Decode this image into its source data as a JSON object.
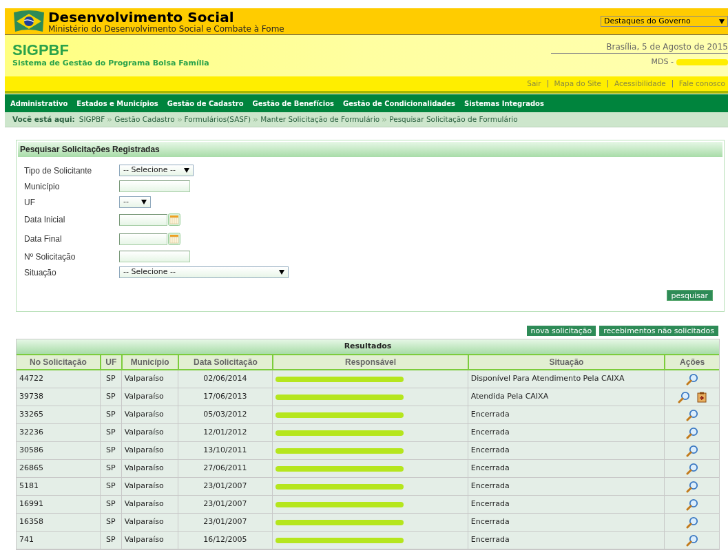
{
  "header": {
    "title": "Desenvolvimento Social",
    "subtitle": "Ministério do Desenvolvimento Social e Combate à Fome",
    "dropdown": "Destaques do Governo"
  },
  "banner": {
    "title": "SIGPBF",
    "subtitle": "Sistema de Gestão do Programa Bolsa Família",
    "date": "Brasília, 5 de Agosto de 2015",
    "user_prefix": "MDS -",
    "user_redacted": true
  },
  "top_links": [
    "Sair",
    "Mapa do Site",
    "Acessibilidade",
    "Fale conosco"
  ],
  "menu": [
    "Administrativo",
    "Estados e Municípios",
    "Gestão de Cadastro",
    "Gestão de Benefícios",
    "Gestão de Condicionalidades",
    "Sistemas Integrados"
  ],
  "breadcrumb": {
    "label": "Você está aqui:",
    "items": [
      "SIGPBF",
      "Gestão Cadastro",
      "Formulários(SASF)",
      "Manter Solicitação de Formulário",
      "Pesquisar Solicitação de Formulário"
    ]
  },
  "search_panel": {
    "title": "Pesquisar Solicitações Registradas",
    "fields": [
      {
        "label": "Tipo de Solicitante",
        "kind": "select",
        "value": "-- Selecione --"
      },
      {
        "label": "Município",
        "kind": "text"
      },
      {
        "label": "UF",
        "kind": "select",
        "value": "--"
      },
      {
        "label": "Data Inicial",
        "kind": "date"
      },
      {
        "label": "Data Final",
        "kind": "date"
      },
      {
        "label": "Nº Solicitação",
        "kind": "text"
      },
      {
        "label": "Situação",
        "kind": "select",
        "value": "-- Selecione --"
      }
    ],
    "button": "pesquisar"
  },
  "result_buttons": [
    "nova solicitação",
    "recebimentos não solicitados"
  ],
  "results": {
    "title": "Resultados",
    "columns": [
      "No Solicitação",
      "UF",
      "Município",
      "Data Solicitação",
      "Responsável",
      "Situação",
      "Ações"
    ],
    "rows": [
      {
        "number": "44722",
        "uf": "SP",
        "municipio": "Valparaíso",
        "date": "02/06/2014",
        "responsavel_redacted": true,
        "situacao": "Disponível Para Atendimento Pela CAIXA",
        "actions": [
          {
            "kind": "view"
          }
        ]
      },
      {
        "number": "39738",
        "uf": "SP",
        "municipio": "Valparaíso",
        "date": "17/06/2013",
        "responsavel_redacted": true,
        "situacao": "Atendida Pela CAIXA",
        "actions": [
          {
            "kind": "view"
          },
          {
            "kind": "receive"
          }
        ]
      },
      {
        "number": "33265",
        "uf": "SP",
        "municipio": "Valparaíso",
        "date": "05/03/2012",
        "responsavel_redacted": true,
        "situacao": "Encerrada",
        "actions": [
          {
            "kind": "view"
          }
        ]
      },
      {
        "number": "32236",
        "uf": "SP",
        "municipio": "Valparaíso",
        "date": "12/01/2012",
        "responsavel_redacted": true,
        "situacao": "Encerrada",
        "actions": [
          {
            "kind": "view"
          }
        ]
      },
      {
        "number": "30586",
        "uf": "SP",
        "municipio": "Valparaíso",
        "date": "13/10/2011",
        "responsavel_redacted": true,
        "situacao": "Encerrada",
        "actions": [
          {
            "kind": "view"
          }
        ]
      },
      {
        "number": "26865",
        "uf": "SP",
        "municipio": "Valparaíso",
        "date": "27/06/2011",
        "responsavel_redacted": true,
        "situacao": "Encerrada",
        "actions": [
          {
            "kind": "view"
          }
        ]
      },
      {
        "number": "5181",
        "uf": "SP",
        "municipio": "Valparaíso",
        "date": "23/01/2007",
        "responsavel_redacted": true,
        "situacao": "Encerrada",
        "actions": [
          {
            "kind": "view"
          }
        ]
      },
      {
        "number": "16991",
        "uf": "SP",
        "municipio": "Valparaíso",
        "date": "23/01/2007",
        "responsavel_redacted": true,
        "situacao": "Encerrada",
        "actions": [
          {
            "kind": "view"
          }
        ]
      },
      {
        "number": "16358",
        "uf": "SP",
        "municipio": "Valparaíso",
        "date": "23/01/2007",
        "responsavel_redacted": true,
        "situacao": "Encerrada",
        "actions": [
          {
            "kind": "view"
          }
        ]
      },
      {
        "number": "741",
        "uf": "SP",
        "municipio": "Valparaíso",
        "date": "16/12/2005",
        "responsavel_redacted": true,
        "situacao": "Encerrada",
        "actions": [
          {
            "kind": "view"
          }
        ]
      }
    ]
  }
}
